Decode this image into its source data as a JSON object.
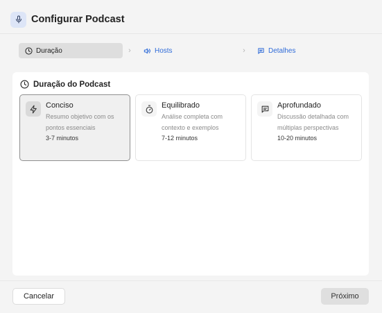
{
  "dialog": {
    "title": "Configurar Podcast",
    "icon": "microphone-icon"
  },
  "steps": [
    {
      "label": "Duração",
      "icon": "clock-icon",
      "state": "active"
    },
    {
      "label": "Hosts",
      "icon": "speaker-icon",
      "state": "upcoming"
    },
    {
      "label": "Detalhes",
      "icon": "message-square-icon",
      "state": "upcoming"
    }
  ],
  "section": {
    "title": "Duração do Podcast",
    "icon": "clock-icon"
  },
  "options": [
    {
      "title": "Conciso",
      "description": "Resumo objetivo com os pontos essenciais",
      "duration": "3-7 minutos",
      "icon": "zap-icon",
      "selected": true
    },
    {
      "title": "Equilibrado",
      "description": "Análise completa com contexto e exemplos",
      "duration": "7-12 minutos",
      "icon": "timer-icon",
      "selected": false
    },
    {
      "title": "Aprofundado",
      "description": "Discussão detalhada com múltiplas perspectivas",
      "duration": "10-20 minutos",
      "icon": "message-lines-icon",
      "selected": false
    }
  ],
  "footer": {
    "cancel_label": "Cancelar",
    "next_label": "Próximo"
  },
  "colors": {
    "accent": "#2f6bd8",
    "header_icon_bg": "#dde5f7",
    "selected_card_bg": "#f0f0f0",
    "next_button_bg": "#dfdfdf"
  }
}
